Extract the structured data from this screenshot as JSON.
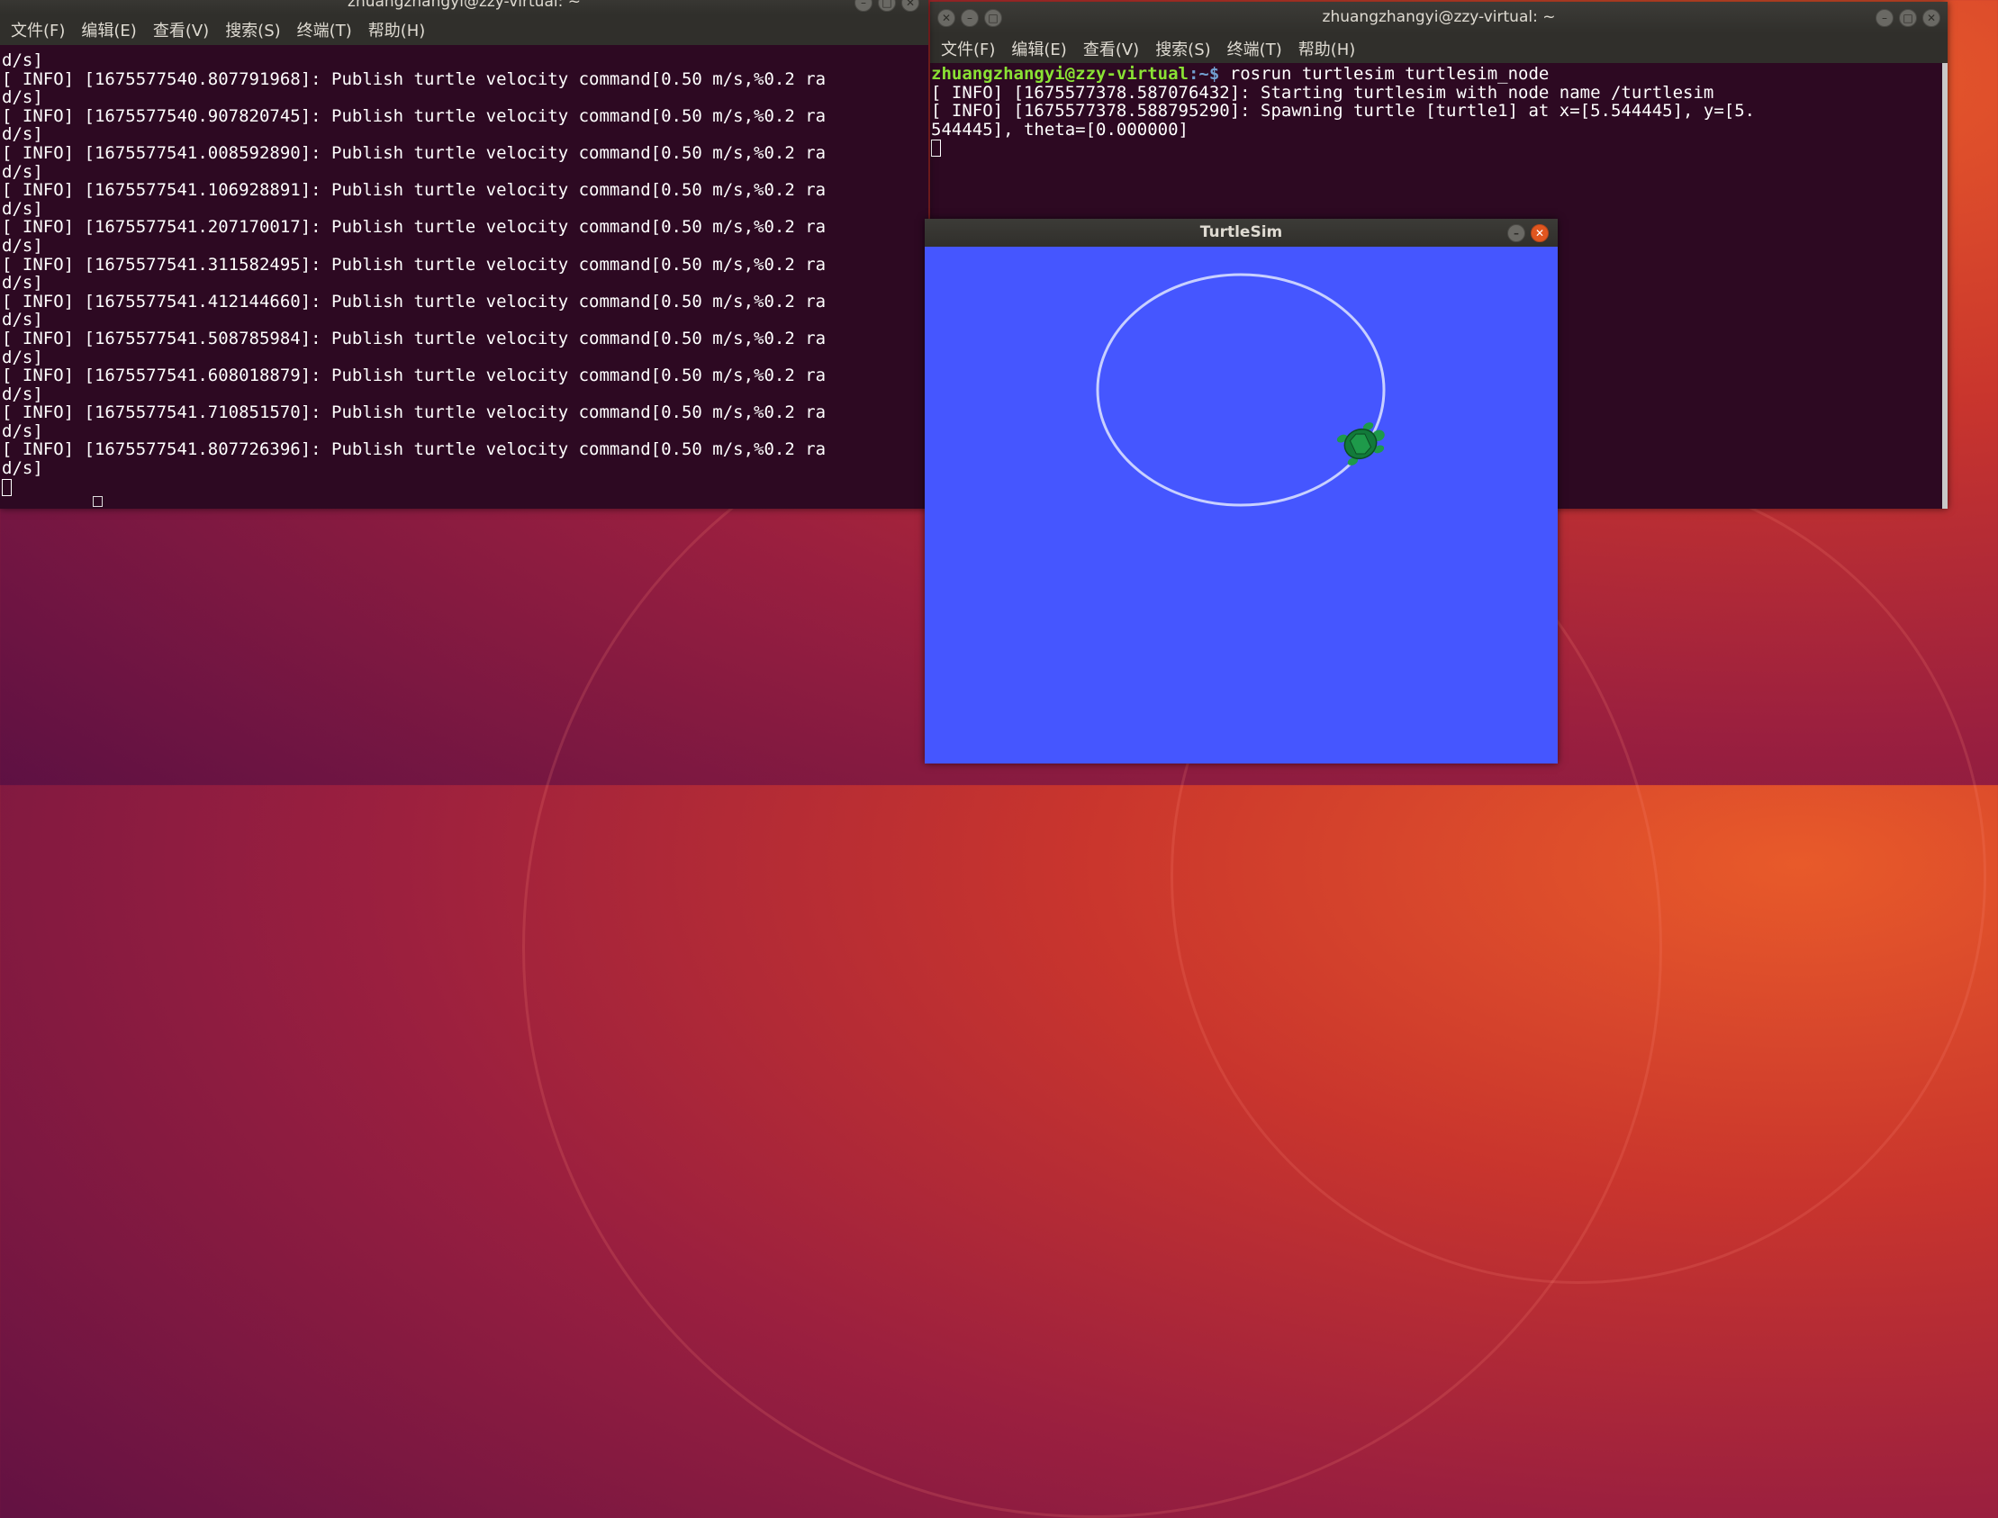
{
  "left_terminal": {
    "title": "zhuangzhangyi@zzy-virtual: ~",
    "menu": [
      "文件(F)",
      "编辑(E)",
      "查看(V)",
      "搜索(S)",
      "终端(T)",
      "帮助(H)"
    ],
    "lines": [
      "d/s]",
      "[ INFO] [1675577540.807791968]: Publish turtle velocity command[0.50 m/s,%0.2 ra",
      "d/s]",
      "[ INFO] [1675577540.907820745]: Publish turtle velocity command[0.50 m/s,%0.2 ra",
      "d/s]",
      "[ INFO] [1675577541.008592890]: Publish turtle velocity command[0.50 m/s,%0.2 ra",
      "d/s]",
      "[ INFO] [1675577541.106928891]: Publish turtle velocity command[0.50 m/s,%0.2 ra",
      "d/s]",
      "[ INFO] [1675577541.207170017]: Publish turtle velocity command[0.50 m/s,%0.2 ra",
      "d/s]",
      "[ INFO] [1675577541.311582495]: Publish turtle velocity command[0.50 m/s,%0.2 ra",
      "d/s]",
      "[ INFO] [1675577541.412144660]: Publish turtle velocity command[0.50 m/s,%0.2 ra",
      "d/s]",
      "[ INFO] [1675577541.508785984]: Publish turtle velocity command[0.50 m/s,%0.2 ra",
      "d/s]",
      "[ INFO] [1675577541.608018879]: Publish turtle velocity command[0.50 m/s,%0.2 ra",
      "d/s]",
      "[ INFO] [1675577541.710851570]: Publish turtle velocity command[0.50 m/s,%0.2 ra",
      "d/s]",
      "[ INFO] [1675577541.807726396]: Publish turtle velocity command[0.50 m/s,%0.2 ra",
      "d/s]"
    ]
  },
  "right_terminal": {
    "title": "zhuangzhangyi@zzy-virtual: ~",
    "menu": [
      "文件(F)",
      "编辑(E)",
      "查看(V)",
      "搜索(S)",
      "终端(T)",
      "帮助(H)"
    ],
    "prompt_user": "zhuangzhangyi@zzy-virtual",
    "prompt_path": ":~$",
    "command": " rosrun turtlesim turtlesim_node",
    "lines": [
      "[ INFO] [1675577378.587076432]: Starting turtlesim with node name /turtlesim",
      "[ INFO] [1675577378.588795290]: Spawning turtle [turtle1] at x=[5.544445], y=[5.",
      "544445], theta=[0.000000]"
    ]
  },
  "turtlesim": {
    "title": "TurtleSim",
    "background": "#4556ff",
    "trail_color": "#c8d0ff",
    "turtle_color": "#1e9a4a"
  },
  "icons": {
    "minimize": "minimize-icon",
    "maximize": "maximize-icon",
    "close": "close-icon"
  }
}
